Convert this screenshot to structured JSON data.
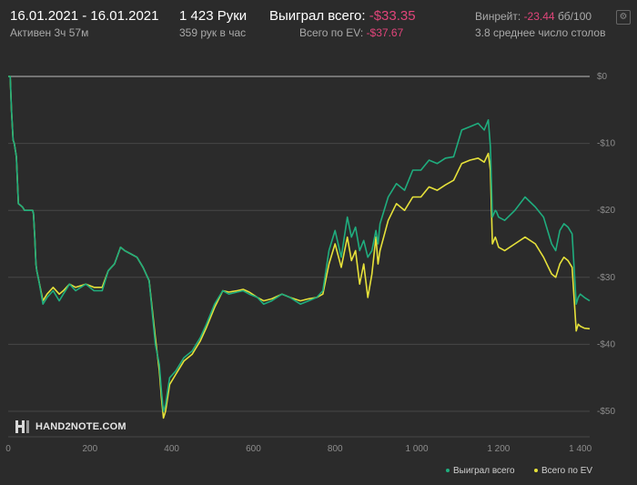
{
  "header": {
    "date_range": "16.01.2021 - 16.01.2021",
    "active_time": "Активен 3ч 57м",
    "hands_count": "1 423 Руки",
    "hands_per_hour": "359 рук в час",
    "won_total_label": "Выиграл всего:",
    "won_total_value": "-$33.35",
    "ev_total_label": "Всего по EV:",
    "ev_total_value": "-$37.67",
    "winrate_label": "Винрейт:",
    "winrate_value": "-23.44",
    "winrate_unit": "бб/100",
    "avg_tables": "3.8 среднее число столов"
  },
  "settings_icon": "gear-icon",
  "logo": {
    "text": "HAND2NOTE.COM"
  },
  "legend": {
    "won_label": "Выиграл всего",
    "ev_label": "Всего по EV"
  },
  "colors": {
    "background": "#2b2b2b",
    "won": "#1fad7e",
    "ev": "#e6e13a",
    "negative": "#e0457a",
    "grid": "#474747"
  },
  "chart_data": {
    "type": "line",
    "xlim": [
      0,
      1423
    ],
    "ylim": [
      -50,
      0
    ],
    "x_ticks": [
      0,
      200,
      400,
      600,
      800,
      1000,
      1200,
      1400
    ],
    "x_tick_labels": [
      "0",
      "200",
      "400",
      "600",
      "800",
      "1 000",
      "1 200",
      "1 400"
    ],
    "y_ticks": [
      0,
      -10,
      -20,
      -30,
      -40,
      -50
    ],
    "y_tick_labels": [
      "$0",
      "-$10",
      "-$20",
      "-$30",
      "-$40",
      "-$50"
    ],
    "series": [
      {
        "name": "Выиграл всего",
        "x": [
          0,
          5,
          8,
          12,
          15,
          20,
          25,
          35,
          40,
          55,
          60,
          62,
          65,
          68,
          70,
          75,
          85,
          95,
          110,
          125,
          135,
          150,
          165,
          190,
          210,
          230,
          245,
          260,
          275,
          285,
          300,
          315,
          330,
          345,
          360,
          370,
          375,
          380,
          385,
          395,
          410,
          430,
          450,
          470,
          485,
          505,
          525,
          540,
          560,
          575,
          590,
          610,
          625,
          645,
          670,
          690,
          715,
          735,
          755,
          770,
          785,
          800,
          815,
          830,
          840,
          850,
          860,
          870,
          880,
          890,
          900,
          905,
          910,
          930,
          950,
          970,
          990,
          1010,
          1030,
          1050,
          1070,
          1090,
          1110,
          1130,
          1150,
          1165,
          1175,
          1180,
          1185,
          1192,
          1195,
          1200,
          1215,
          1240,
          1265,
          1290,
          1310,
          1330,
          1340,
          1350,
          1360,
          1370,
          1380,
          1390,
          1395,
          1400,
          1410,
          1423
        ],
        "y": [
          0,
          0,
          -5,
          -9.5,
          -10,
          -12,
          -19,
          -19.5,
          -20,
          -20,
          -20,
          -20.5,
          -24,
          -28,
          -29,
          -30.5,
          -34,
          -33,
          -32,
          -33.5,
          -32.5,
          -31,
          -32,
          -31,
          -32,
          -32,
          -29,
          -28,
          -25.5,
          -26,
          -26.5,
          -27,
          -28.5,
          -30.5,
          -40,
          -43,
          -47,
          -50,
          -49,
          -45,
          -44,
          -42,
          -41,
          -39,
          -37,
          -34,
          -32,
          -32.5,
          -32.2,
          -32,
          -32.5,
          -33,
          -34,
          -33.5,
          -32.5,
          -33,
          -34,
          -33.5,
          -33,
          -32,
          -26,
          -23,
          -27,
          -21,
          -24,
          -22.5,
          -26,
          -24.5,
          -27,
          -26,
          -23,
          -25,
          -22,
          -18,
          -16,
          -17,
          -14,
          -14,
          -12.5,
          -13,
          -12.2,
          -12,
          -8,
          -7.5,
          -7,
          -8,
          -6.5,
          -10.5,
          -21,
          -20,
          -20.2,
          -21,
          -21.5,
          -20,
          -18,
          -19.5,
          -21,
          -25,
          -26,
          -23,
          -22,
          -22.5,
          -23.5,
          -34,
          -33,
          -32.5,
          -33,
          -33.5
        ]
      },
      {
        "name": "Всего по EV",
        "x": [
          0,
          5,
          8,
          12,
          15,
          20,
          25,
          35,
          40,
          55,
          60,
          62,
          65,
          68,
          70,
          75,
          85,
          95,
          110,
          125,
          135,
          150,
          165,
          190,
          210,
          230,
          245,
          260,
          275,
          285,
          300,
          315,
          330,
          345,
          360,
          370,
          375,
          380,
          385,
          395,
          410,
          430,
          450,
          470,
          485,
          505,
          525,
          540,
          560,
          575,
          590,
          610,
          625,
          645,
          670,
          690,
          715,
          735,
          755,
          770,
          785,
          800,
          815,
          830,
          840,
          850,
          860,
          870,
          880,
          890,
          900,
          905,
          910,
          930,
          950,
          970,
          990,
          1010,
          1030,
          1050,
          1070,
          1090,
          1110,
          1130,
          1150,
          1165,
          1175,
          1180,
          1185,
          1192,
          1195,
          1200,
          1215,
          1240,
          1265,
          1290,
          1310,
          1330,
          1340,
          1350,
          1360,
          1370,
          1380,
          1390,
          1395,
          1400,
          1410,
          1423
        ],
        "y": [
          0,
          0,
          -5,
          -9.5,
          -10,
          -12,
          -19,
          -19.5,
          -20,
          -20,
          -20,
          -20.5,
          -24,
          -28,
          -29,
          -30.5,
          -33.5,
          -32.5,
          -31.5,
          -32.5,
          -32,
          -31,
          -31.5,
          -31,
          -31.5,
          -31.5,
          -29,
          -28,
          -25.5,
          -26,
          -26.5,
          -27,
          -28.5,
          -30.5,
          -39,
          -44,
          -48,
          -51,
          -50,
          -46,
          -44.5,
          -42.5,
          -41.5,
          -39.5,
          -37.5,
          -34.5,
          -32,
          -32.2,
          -32,
          -31.8,
          -32.2,
          -33,
          -33.5,
          -33.2,
          -32.5,
          -33,
          -33.5,
          -33.2,
          -33,
          -32.5,
          -28,
          -25,
          -28.5,
          -24,
          -27.5,
          -26,
          -31,
          -28,
          -33,
          -29.5,
          -24,
          -28,
          -26,
          -21.5,
          -19,
          -20,
          -18,
          -18,
          -16.5,
          -17,
          -16.2,
          -15.5,
          -13,
          -12.5,
          -12.2,
          -12.8,
          -11.5,
          -14,
          -25,
          -24,
          -24.5,
          -25.5,
          -26,
          -25,
          -24,
          -25,
          -27,
          -29.5,
          -30,
          -28,
          -27,
          -27.5,
          -28.5,
          -38,
          -37,
          -37.3,
          -37.6,
          -37.67
        ]
      }
    ]
  }
}
